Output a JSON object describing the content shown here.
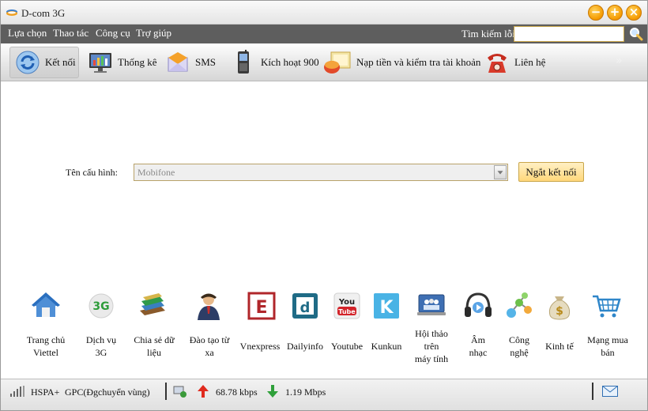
{
  "app": {
    "title": "D-com 3G"
  },
  "window_buttons": {
    "minimize": "−",
    "maximize": "+",
    "close": "×"
  },
  "menu": {
    "items": [
      "Lựa chọn",
      "Thao tác",
      "Công cụ",
      "Trợ giúp"
    ],
    "search_label": "Tìm kiếm lỗi",
    "search_value": ""
  },
  "toolbar": {
    "items": [
      {
        "label": "Kết nối",
        "icon": "refresh-connect-icon",
        "active": true
      },
      {
        "label": "Thống kê",
        "icon": "statistics-monitor-icon"
      },
      {
        "label": "SMS",
        "icon": "envelope-icon"
      },
      {
        "label": "Kích hoạt 900",
        "icon": "mobile-phone-icon"
      },
      {
        "label": "Nạp tiền và kiểm tra tài khoản",
        "icon": "topup-card-icon"
      },
      {
        "label": "Liên hệ",
        "icon": "telephone-icon"
      }
    ],
    "more": "»"
  },
  "connection": {
    "config_label": "Tên cấu hình:",
    "config_value": "Mobifone",
    "disconnect_label": "Ngắt kết nối"
  },
  "shortcuts": [
    {
      "label_lines": [
        "Trang chủ",
        "Viettel"
      ],
      "icon": "home-icon"
    },
    {
      "label_lines": [
        "Dịch vụ",
        "3G"
      ],
      "icon": "3g-icon"
    },
    {
      "label_lines": [
        "Chia sẻ dữ",
        "liệu"
      ],
      "icon": "books-icon"
    },
    {
      "label_lines": [
        "Đào tạo từ",
        "xa"
      ],
      "icon": "person-icon"
    },
    {
      "label_lines": [
        "Vnexpress"
      ],
      "icon": "vnexpress-icon"
    },
    {
      "label_lines": [
        "Dailyinfo"
      ],
      "icon": "dailyinfo-icon"
    },
    {
      "label_lines": [
        "Youtube"
      ],
      "icon": "youtube-icon"
    },
    {
      "label_lines": [
        "Kunkun"
      ],
      "icon": "kunkun-icon"
    },
    {
      "label_lines": [
        "Hội thảo",
        "trên",
        "máy tính"
      ],
      "icon": "video-conference-icon"
    },
    {
      "label_lines": [
        "Âm",
        "nhạc"
      ],
      "icon": "headphones-icon"
    },
    {
      "label_lines": [
        "Công",
        "nghệ"
      ],
      "icon": "molecule-icon"
    },
    {
      "label_lines": [
        "Kinh tế"
      ],
      "icon": "money-bag-icon"
    },
    {
      "label_lines": [
        "Mạng mua",
        "bán"
      ],
      "icon": "shopping-cart-icon"
    }
  ],
  "status": {
    "signal_icon": "signal-bars-icon",
    "network_type": "HSPA+",
    "operator": "GPC(Đgchuyển vùng)",
    "upload_speed": "68.78 kbps",
    "download_speed": "1.19 Mbps",
    "mail_icon": "mail-icon"
  },
  "colors": {
    "menubar": "#5e5e5e",
    "accent": "#f59a00",
    "button_bg": "#ffd77a"
  }
}
